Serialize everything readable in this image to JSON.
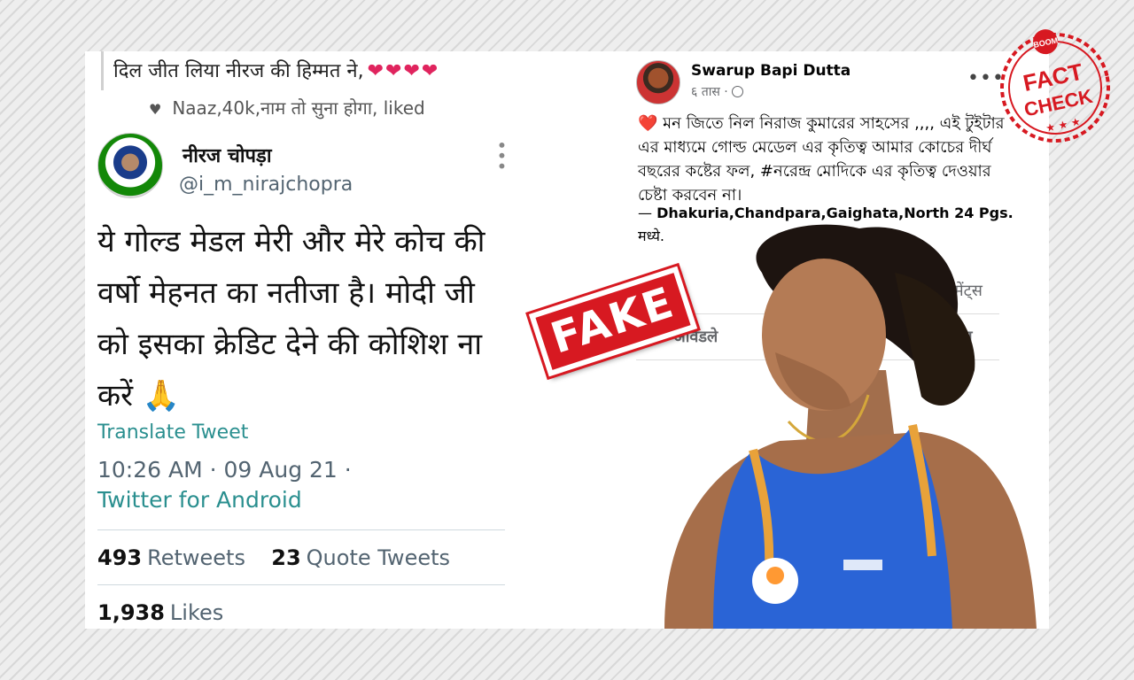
{
  "tweet": {
    "reply_text": "दिल जीत लिया नीरज की हिम्मत ने,",
    "reply_hearts": "❤❤❤❤",
    "liked_text": "Naaz,40k,नाम तो सुना होगा, liked",
    "author_name": "नीरज चोपड़ा",
    "author_handle": "@i_m_nirajchopra",
    "body": "ये गोल्ड मेडल मेरी और मेरे कोच की वर्षो मेहनत का नतीजा है। मोदी जी को इसका क्रेडिट देने की कोशिश ना करें 🙏",
    "translate_label": "Translate Tweet",
    "time": "10:26 AM · 09 Aug 21 ·",
    "source": "Twitter for Android",
    "retweets_count": "493",
    "retweets_label": "Retweets",
    "quotes_count": "23",
    "quotes_label": "Quote Tweets",
    "likes_count": "1,938",
    "likes_label": "Likes"
  },
  "facebook": {
    "author_name": "Swarup Bapi Dutta",
    "meta": "६ तास ·",
    "text": "মন জিতে নিল নিরাজ কুমারের সাহসের ,,,, এই টুইটার এর মাধ্যমে গোল্ড মেডেল এর কৃতিত্ব আমার কোচের দীর্ঘ বছরের কষ্টের ফল, #নরেন্দ্র মোদিকে এর কৃতিত্ব দেওয়ার চেষ্টা করবেন না।",
    "location_prefix": "—",
    "location": "Dhakuria,Chandpara,Gaighata,North 24 Pgs.",
    "location_suffix": "मध्ये.",
    "comments": "८ कमेंट्स",
    "action_like": "आवडले",
    "action_share": "र करा"
  },
  "stamp": {
    "fake_text": "FAKE"
  },
  "logo": {
    "top_text": "BOOM",
    "line1": "FACT",
    "line2": "CHECK"
  },
  "colors": {
    "stamp_red": "#d71921",
    "twitter_link": "#2a8f8f",
    "fb_blue": "#1877f2"
  }
}
